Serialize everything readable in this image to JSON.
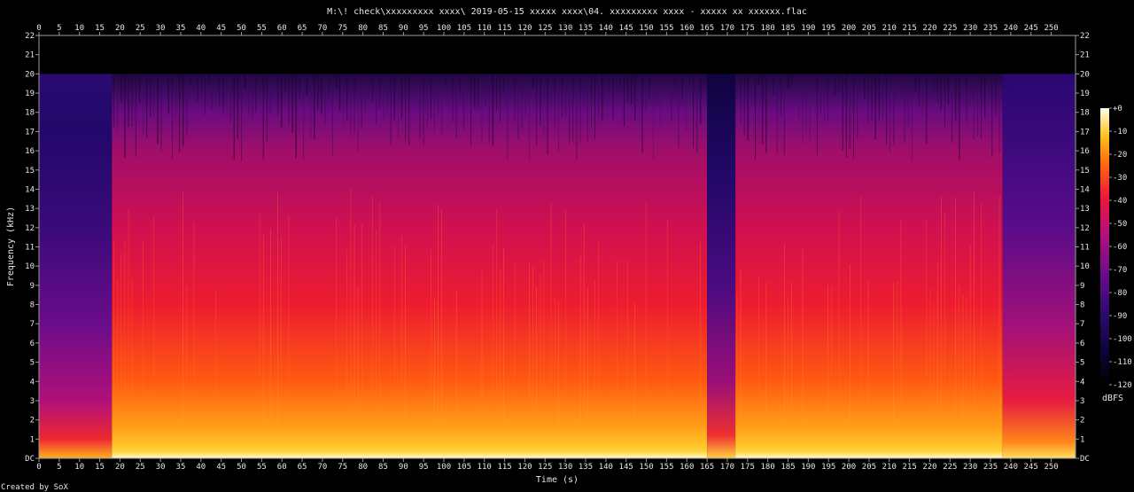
{
  "chart_data": {
    "type": "heatmap",
    "title": "M:\\! check\\xxxxxxxxx xxxx\\ 2019-05-15  xxxxx xxxx\\04. xxxxxxxxx xxxx - xxxxx xx xxxxxx.flac",
    "xlabel": "Time (s)",
    "ylabel": "Frequency (kHz)",
    "xlim": [
      0,
      256
    ],
    "ylim": [
      0,
      22
    ],
    "x_ticks": [
      0,
      5,
      10,
      15,
      20,
      25,
      30,
      35,
      40,
      45,
      50,
      55,
      60,
      65,
      70,
      75,
      80,
      85,
      90,
      95,
      100,
      105,
      110,
      115,
      120,
      125,
      130,
      135,
      140,
      145,
      150,
      155,
      160,
      165,
      170,
      175,
      180,
      185,
      190,
      195,
      200,
      205,
      210,
      215,
      220,
      225,
      230,
      235,
      240,
      245,
      250
    ],
    "y_ticks": [
      "DC",
      "1",
      "2",
      "3",
      "4",
      "5",
      "6",
      "7",
      "8",
      "9",
      "10",
      "11",
      "12",
      "13",
      "14",
      "15",
      "16",
      "17",
      "18",
      "19",
      "20",
      "21",
      "22"
    ],
    "colorbar": {
      "label": "dBFS",
      "ticks": [
        "+0",
        "-10",
        "-20",
        "-30",
        "-40",
        "-50",
        "-60",
        "-70",
        "-80",
        "-90",
        "-100",
        "-110",
        "-120"
      ],
      "range": [
        -120,
        0
      ]
    },
    "spectral_cutoff_khz": 20,
    "segments": [
      {
        "t_start": 0,
        "t_end": 18,
        "level": "quiet intro"
      },
      {
        "t_start": 18,
        "t_end": 165,
        "level": "loud"
      },
      {
        "t_start": 165,
        "t_end": 172,
        "level": "quieter dip"
      },
      {
        "t_start": 172,
        "t_end": 238,
        "level": "loud"
      },
      {
        "t_start": 238,
        "t_end": 256,
        "level": "fade / quieter outro"
      }
    ]
  },
  "footer": {
    "credit": "Created by SoX"
  }
}
